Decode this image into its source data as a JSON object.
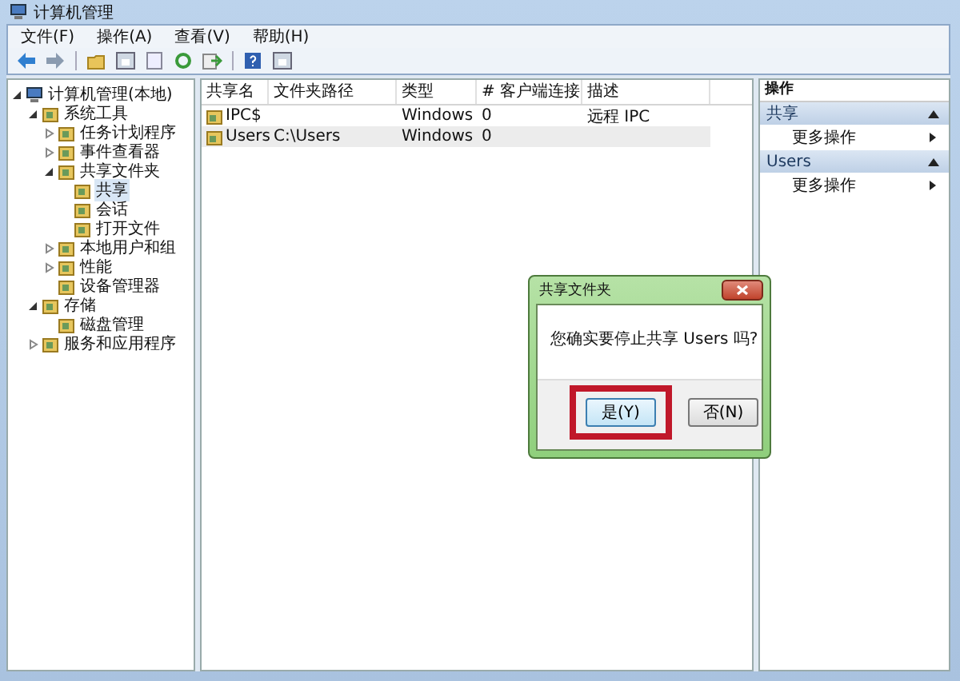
{
  "window": {
    "title": "计算机管理"
  },
  "menu": [
    "文件(F)",
    "操作(A)",
    "查看(V)",
    "帮助(H)"
  ],
  "tree": [
    {
      "label": "计算机管理(本地)",
      "selected": false,
      "expanded": true,
      "children": [
        {
          "label": "系统工具",
          "selected": false,
          "expanded": true,
          "children": [
            {
              "label": "任务计划程序",
              "selected": false,
              "expanded": false
            },
            {
              "label": "事件查看器",
              "selected": false,
              "expanded": false
            },
            {
              "label": "共享文件夹",
              "selected": false,
              "expanded": true,
              "children": [
                {
                  "label": "共享",
                  "selected": true
                },
                {
                  "label": "会话",
                  "selected": false
                },
                {
                  "label": "打开文件",
                  "selected": false
                }
              ]
            },
            {
              "label": "本地用户和组",
              "selected": false,
              "expanded": false
            },
            {
              "label": "性能",
              "selected": false,
              "expanded": false
            },
            {
              "label": "设备管理器",
              "selected": false
            }
          ]
        },
        {
          "label": "存储",
          "selected": false,
          "expanded": true,
          "children": [
            {
              "label": "磁盘管理",
              "selected": false
            }
          ]
        },
        {
          "label": "服务和应用程序",
          "selected": false,
          "expanded": false
        }
      ]
    }
  ],
  "table": {
    "columns": [
      "共享名",
      "文件夹路径",
      "类型",
      "# 客户端连接",
      "描述"
    ],
    "rows": [
      {
        "selected": false,
        "cells": [
          "IPC$",
          "",
          "Windows",
          "0",
          "远程 IPC"
        ]
      },
      {
        "selected": true,
        "cells": [
          "Users",
          "C:\\Users",
          "Windows",
          "0",
          ""
        ]
      }
    ]
  },
  "actions": {
    "title": "操作",
    "sections": [
      {
        "title": "共享",
        "expanded": true,
        "items": [
          "更多操作"
        ]
      },
      {
        "title": "Users",
        "expanded": true,
        "items": [
          "更多操作"
        ]
      }
    ]
  },
  "dialog": {
    "title": "共享文件夹",
    "message": "您确实要停止共享 Users 吗?",
    "buttons": [
      {
        "label": "是(Y)",
        "default": true,
        "highlighted": true
      },
      {
        "label": "否(N)",
        "default": false,
        "highlighted": false
      }
    ]
  }
}
